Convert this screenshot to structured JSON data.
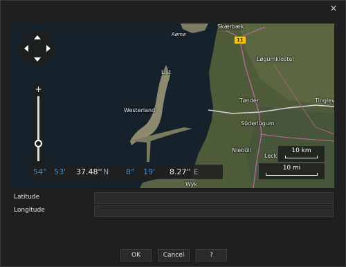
{
  "window": {
    "close_label": "×"
  },
  "map": {
    "places": {
      "skaerbaek": "Skærbæk",
      "romo": "Rømø",
      "logumkloster": "Løgumkloster",
      "list": "List",
      "westerland": "Westerland",
      "tonder": "Tønder",
      "tinglev": "Tinglev",
      "suderlugum": "Süderlügum",
      "niebull": "Niebüll",
      "leck": "Leck",
      "wyk": "Wyk"
    },
    "road_shield": "11",
    "scale_km": "10 km",
    "scale_mi": "10 mi",
    "zoom_plus": "+",
    "zoom_level": 0.27,
    "coords": {
      "lat_deg": "54°",
      "lat_min": "53'",
      "lat_sec": "37.48''",
      "lat_hem": "N",
      "lon_deg": "8°",
      "lon_min": "19'",
      "lon_sec": "8.27''",
      "lon_hem": "E"
    }
  },
  "fields": {
    "latitude_label": "Latitude",
    "latitude_value": "",
    "longitude_label": "Longitude",
    "longitude_value": ""
  },
  "buttons": {
    "ok": "OK",
    "cancel": "Cancel",
    "help": "?"
  },
  "colors": {
    "background": "#1f1f1f",
    "accent_blue": "#3d8ee0",
    "water": "#15212b",
    "land": "#4f5c3a"
  }
}
